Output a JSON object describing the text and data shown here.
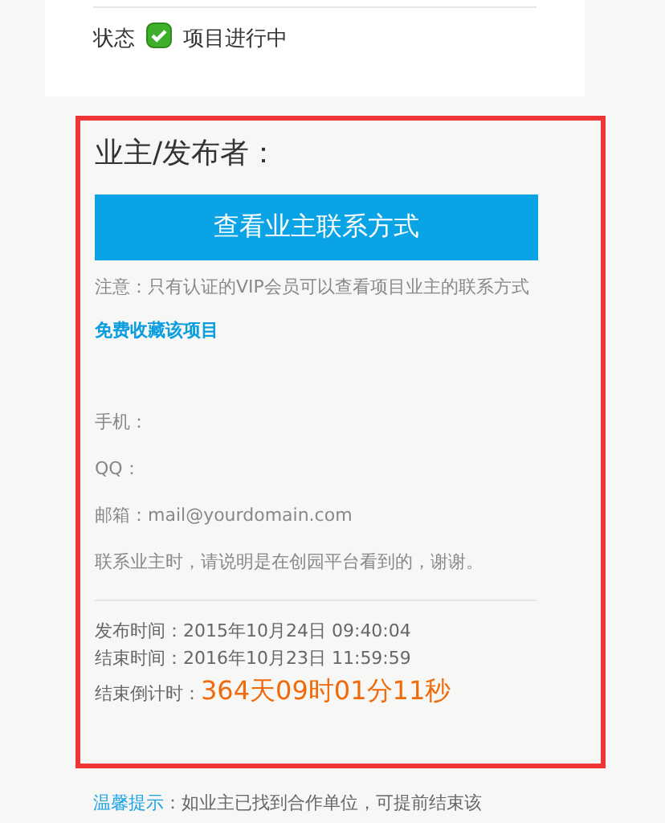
{
  "status": {
    "label": "状态",
    "value": "项目进行中"
  },
  "owner_panel": {
    "title": "业主/发布者：",
    "contact_button": "查看业主联系方式",
    "notice": "注意：只有认证的VIP会员可以查看项目业主的联系方式",
    "favorite_link": "免费收藏该项目",
    "contacts": [
      "手机：",
      "QQ：",
      "邮箱：mail@yourdomain.com"
    ],
    "contact_note": "联系业主时，请说明是在创园平台看到的，谢谢。",
    "publish_time": "发布时间：2015年10月24日 09:40:04",
    "end_time": "结束时间：2016年10月23日 11:59:59",
    "countdown_label": "结束倒计时：",
    "countdown": "364天09时01分11秒"
  },
  "tip": {
    "label": "温馨提示",
    "text": "：如业主已找到合作单位，可提前结束该"
  }
}
